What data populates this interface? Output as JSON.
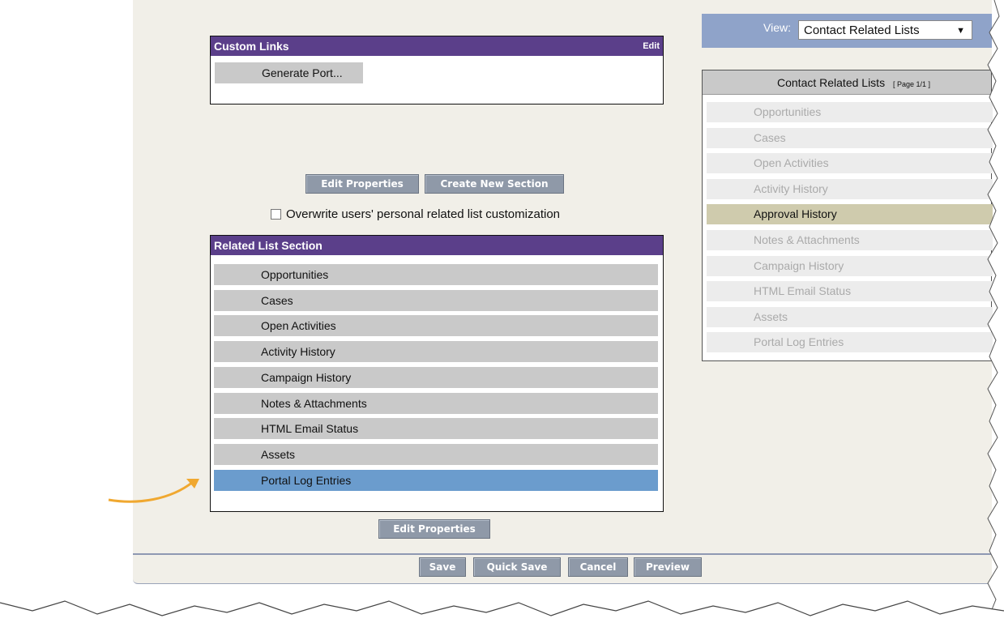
{
  "custom_links": {
    "title": "Custom Links",
    "edit_label": "Edit",
    "item": "Generate Port..."
  },
  "buttons": {
    "edit_properties_top": "Edit Properties",
    "create_new_section": "Create New Section",
    "edit_properties_bottom": "Edit Properties",
    "save": "Save",
    "quick_save": "Quick Save",
    "cancel": "Cancel",
    "preview": "Preview"
  },
  "overwrite_checkbox": {
    "label": "Overwrite users' personal related list customization",
    "checked": false
  },
  "related_list_section": {
    "title": "Related List Section",
    "items": [
      "Opportunities",
      "Cases",
      "Open Activities",
      "Activity History",
      "Campaign History",
      "Notes & Attachments",
      "HTML Email Status",
      "Assets",
      "Portal Log Entries"
    ],
    "selected_index": 8
  },
  "view": {
    "label": "View:",
    "selected": "Contact Related Lists"
  },
  "right_panel": {
    "title": "Contact Related Lists",
    "page": "[ Page 1/1 ]",
    "items": [
      "Opportunities",
      "Cases",
      "Open Activities",
      "Activity History",
      "Approval History",
      "Notes & Attachments",
      "Campaign History",
      "HTML Email Status",
      "Assets",
      "Portal Log Entries"
    ],
    "active_index": 4
  },
  "colors": {
    "header_purple": "#5b3f8a",
    "selected_blue": "#6b9ccd",
    "active_tan": "#cfcbad",
    "arrow_orange": "#f0a830"
  }
}
